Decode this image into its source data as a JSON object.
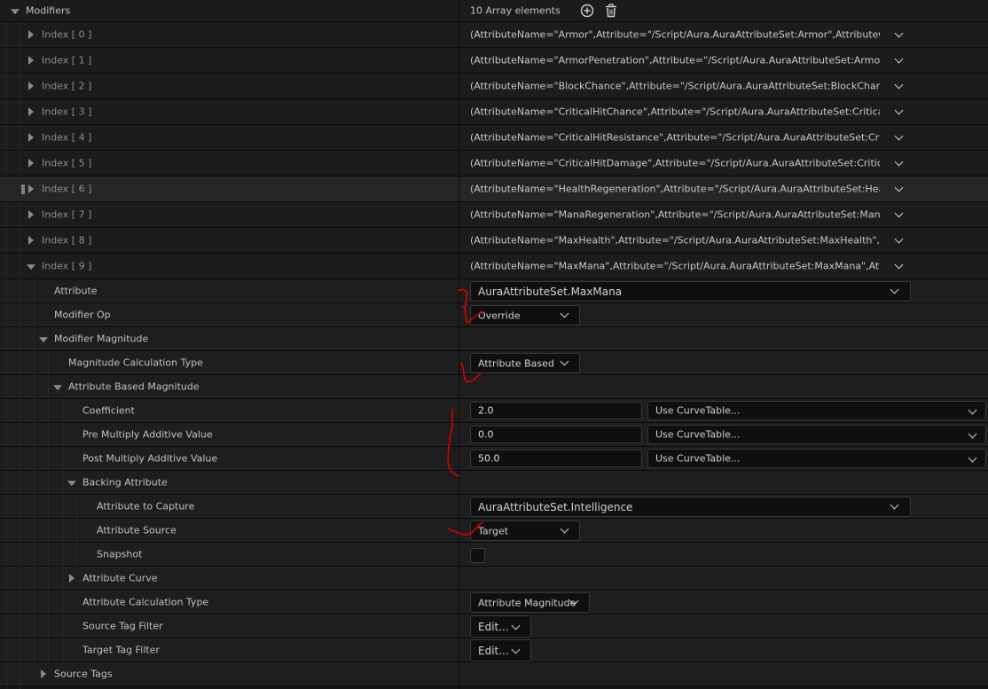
{
  "header": {
    "title": "Modifiers",
    "array_count": "10 Array elements",
    "add_icon": "add-element-icon",
    "delete_icon": "trash-icon"
  },
  "index_rows": [
    {
      "label": "Index [ 0 ]",
      "value": "(AttributeName=\"Armor\",Attribute=\"/Script/Aura.AuraAttributeSet:Armor\",AttributeOwner=N"
    },
    {
      "label": "Index [ 1 ]",
      "value": "(AttributeName=\"ArmorPenetration\",Attribute=\"/Script/Aura.AuraAttributeSet:ArmorPenetra"
    },
    {
      "label": "Index [ 2 ]",
      "value": "(AttributeName=\"BlockChance\",Attribute=\"/Script/Aura.AuraAttributeSet:BlockChance\",Attri"
    },
    {
      "label": "Index [ 3 ]",
      "value": "(AttributeName=\"CriticalHitChance\",Attribute=\"/Script/Aura.AuraAttributeSet:CriticalHitCha"
    },
    {
      "label": "Index [ 4 ]",
      "value": "(AttributeName=\"CriticalHitResistance\",Attribute=\"/Script/Aura.AuraAttributeSet:CriticalHit"
    },
    {
      "label": "Index [ 5 ]",
      "value": "(AttributeName=\"CriticalHitDamage\",Attribute=\"/Script/Aura.AuraAttributeSet:CriticalHitDar"
    },
    {
      "label": "Index [ 6 ]",
      "value": "(AttributeName=\"HealthRegeneration\",Attribute=\"/Script/Aura.AuraAttributeSet:HealthRege"
    },
    {
      "label": "Index [ 7 ]",
      "value": "(AttributeName=\"ManaRegeneration\",Attribute=\"/Script/Aura.AuraAttributeSet:ManaRegene"
    },
    {
      "label": "Index [ 8 ]",
      "value": "(AttributeName=\"MaxHealth\",Attribute=\"/Script/Aura.AuraAttributeSet:MaxHealth\",Attribute"
    },
    {
      "label": "Index [ 9 ]",
      "value": "(AttributeName=\"MaxMana\",Attribute=\"/Script/Aura.AuraAttributeSet:MaxMana\",AttributeO"
    }
  ],
  "details": {
    "attribute": {
      "label": "Attribute",
      "value": "AuraAttributeSet.MaxMana"
    },
    "modifier_op": {
      "label": "Modifier Op",
      "value": "Override"
    },
    "modifier_magnitude": {
      "label": "Modifier Magnitude"
    },
    "magnitude_calc_type": {
      "label": "Magnitude Calculation Type",
      "value": "Attribute Based"
    },
    "attribute_based_magnitude": {
      "label": "Attribute Based Magnitude"
    },
    "coefficient": {
      "label": "Coefficient",
      "value": "2.0",
      "curve": "Use CurveTable..."
    },
    "pre_multiply": {
      "label": "Pre Multiply Additive Value",
      "value": "0.0",
      "curve": "Use CurveTable..."
    },
    "post_multiply": {
      "label": "Post Multiply Additive Value",
      "value": "50.0",
      "curve": "Use CurveTable..."
    },
    "backing_attribute": {
      "label": "Backing Attribute"
    },
    "attribute_to_capture": {
      "label": "Attribute to Capture",
      "value": "AuraAttributeSet.Intelligence"
    },
    "attribute_source": {
      "label": "Attribute Source",
      "value": "Target"
    },
    "snapshot": {
      "label": "Snapshot",
      "checked": false
    },
    "attribute_curve": {
      "label": "Attribute Curve"
    },
    "attribute_calc_type": {
      "label": "Attribute Calculation Type",
      "value": "Attribute Magnitude"
    },
    "source_tag_filter": {
      "label": "Source Tag Filter",
      "button": "Edit..."
    },
    "target_tag_filter": {
      "label": "Target Tag Filter",
      "button": "Edit..."
    },
    "source_tags": {
      "label": "Source Tags"
    }
  },
  "colors": {
    "background": "#151515",
    "row": "#1e1e1e",
    "row_highlight": "#262626",
    "annotation": "#d40000"
  }
}
